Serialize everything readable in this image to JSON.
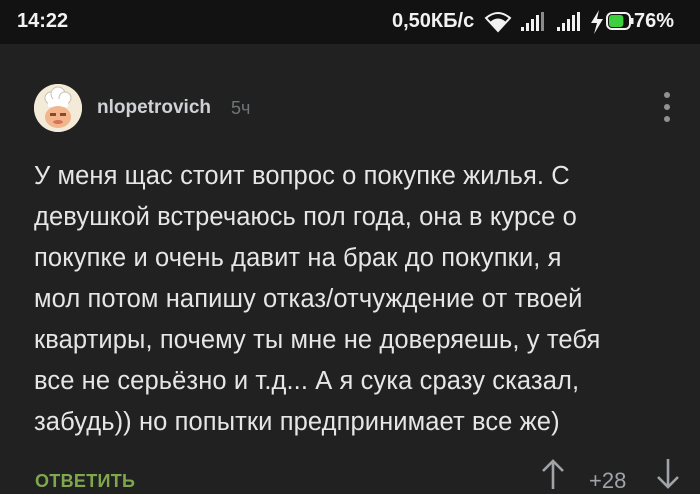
{
  "status_bar": {
    "time": "14:22",
    "network_speed": "0,50КБ/с",
    "battery_percent": "76%",
    "battery_level": 0.76,
    "icons": [
      "wifi-icon",
      "signal-icon",
      "signal-icon",
      "charging-icon",
      "battery-icon"
    ]
  },
  "comment": {
    "author": "nlopetrovich",
    "time_ago": "5ч",
    "text_lines": [
      "У меня щас стоит вопрос о покупке жилья. С",
      "девушкой встречаюсь пол года, она в курсе о",
      "покупке и очень давит на брак до покупки, я",
      "мол потом напишу отказ/отчуждение от твоей",
      "квартиры, почему ты мне не доверяешь, у тебя",
      "все не серьёзно и т.д... А я сука сразу сказал,",
      "забудь)) но попытки предпринимает все же)"
    ],
    "reply_label": "ОТВЕТИТЬ",
    "rating": "+28"
  },
  "colors": {
    "background": "#212121",
    "status_bar": "#121212",
    "reply_accent": "#7fa84d",
    "battery_accent": "#3ecf3e"
  }
}
